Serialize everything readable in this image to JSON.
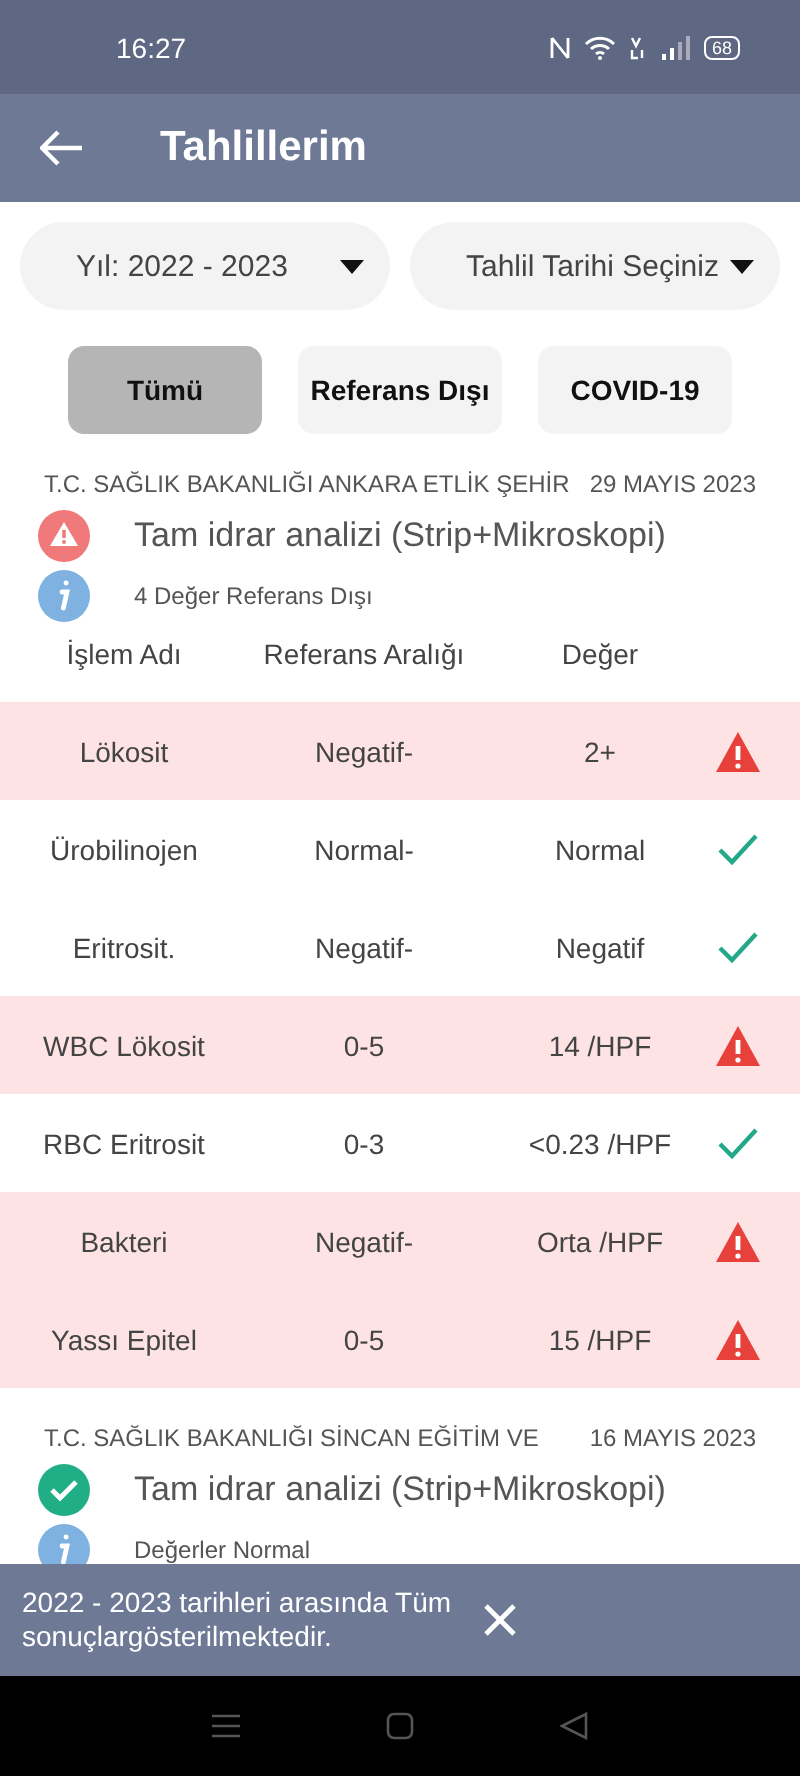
{
  "status_bar": {
    "time": "16:27",
    "battery": "68"
  },
  "app_bar": {
    "title": "Tahlillerim"
  },
  "dropdowns": [
    {
      "label": "Yıl: 2022 - 2023"
    },
    {
      "label": "Tahlil Tarihi Seçiniz"
    }
  ],
  "filters": [
    {
      "label": "Tümü",
      "selected": true
    },
    {
      "label": "Referans Dışı",
      "selected": false
    },
    {
      "label": "COVID-19",
      "selected": false
    }
  ],
  "results": [
    {
      "institution": "T.C. SAĞLIK BAKANLIĞI ANKARA ETLİK ŞEHİR",
      "date": "29 MAYIS 2023",
      "flagged": true,
      "test": "Tam idrar analizi (Strip+Mikroskopi)",
      "summary": "4 Değer Referans Dışı",
      "columns": [
        "İşlem Adı",
        "Referans Aralığı",
        "Değer"
      ],
      "rows": [
        {
          "name": "Lökosit",
          "range": "Negatif-",
          "value": "2+",
          "abnormal": true
        },
        {
          "name": "Ürobilinojen",
          "range": "Normal-",
          "value": "Normal",
          "abnormal": false
        },
        {
          "name": "Eritrosit.",
          "range": "Negatif-",
          "value": "Negatif",
          "abnormal": false
        },
        {
          "name": "WBC Lökosit",
          "range": "0-5",
          "value": "14 /HPF",
          "abnormal": true
        },
        {
          "name": "RBC Eritrosit",
          "range": "0-3",
          "value": "<0.23 /HPF",
          "abnormal": false
        },
        {
          "name": "Bakteri",
          "range": "Negatif-",
          "value": "Orta /HPF",
          "abnormal": true
        },
        {
          "name": "Yassı Epitel",
          "range": "0-5",
          "value": "15 /HPF",
          "abnormal": true
        }
      ]
    },
    {
      "institution": "T.C. SAĞLIK BAKANLIĞI SİNCAN EĞİTİM VE",
      "date": "16 MAYIS 2023",
      "flagged": false,
      "test": "Tam idrar analizi (Strip+Mikroskopi)",
      "summary": "Değerler Normal"
    }
  ],
  "snackbar": {
    "message": "2022 - 2023 tarihleri arasında Tüm sonuçlargösterilmektedir."
  }
}
